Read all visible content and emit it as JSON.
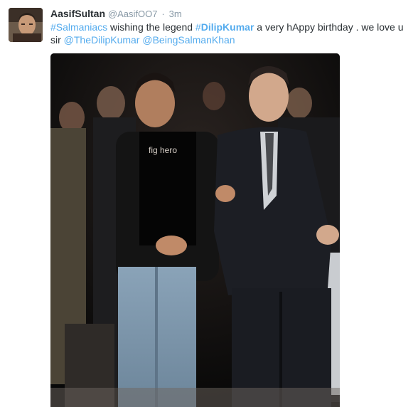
{
  "tweet": {
    "fullname": "AasifSultan",
    "username": "@AasifOO7",
    "separator": "·",
    "time": "3m",
    "text": {
      "tag1": "#Salmaniacs",
      "seg1": " wishing the legend ",
      "tag2_hash": "#",
      "tag2_word": "DilipKumar",
      "seg2": " a very hAppy birthday . we love u sir ",
      "mention1": "@TheDilipKumar",
      "seg3": " ",
      "mention2": "@BeingSalmanKhan"
    },
    "image": {
      "shirt_print": "fig hero"
    },
    "colors": {
      "link": "#55acee",
      "text": "#292f33",
      "meta": "#8899a6"
    }
  }
}
